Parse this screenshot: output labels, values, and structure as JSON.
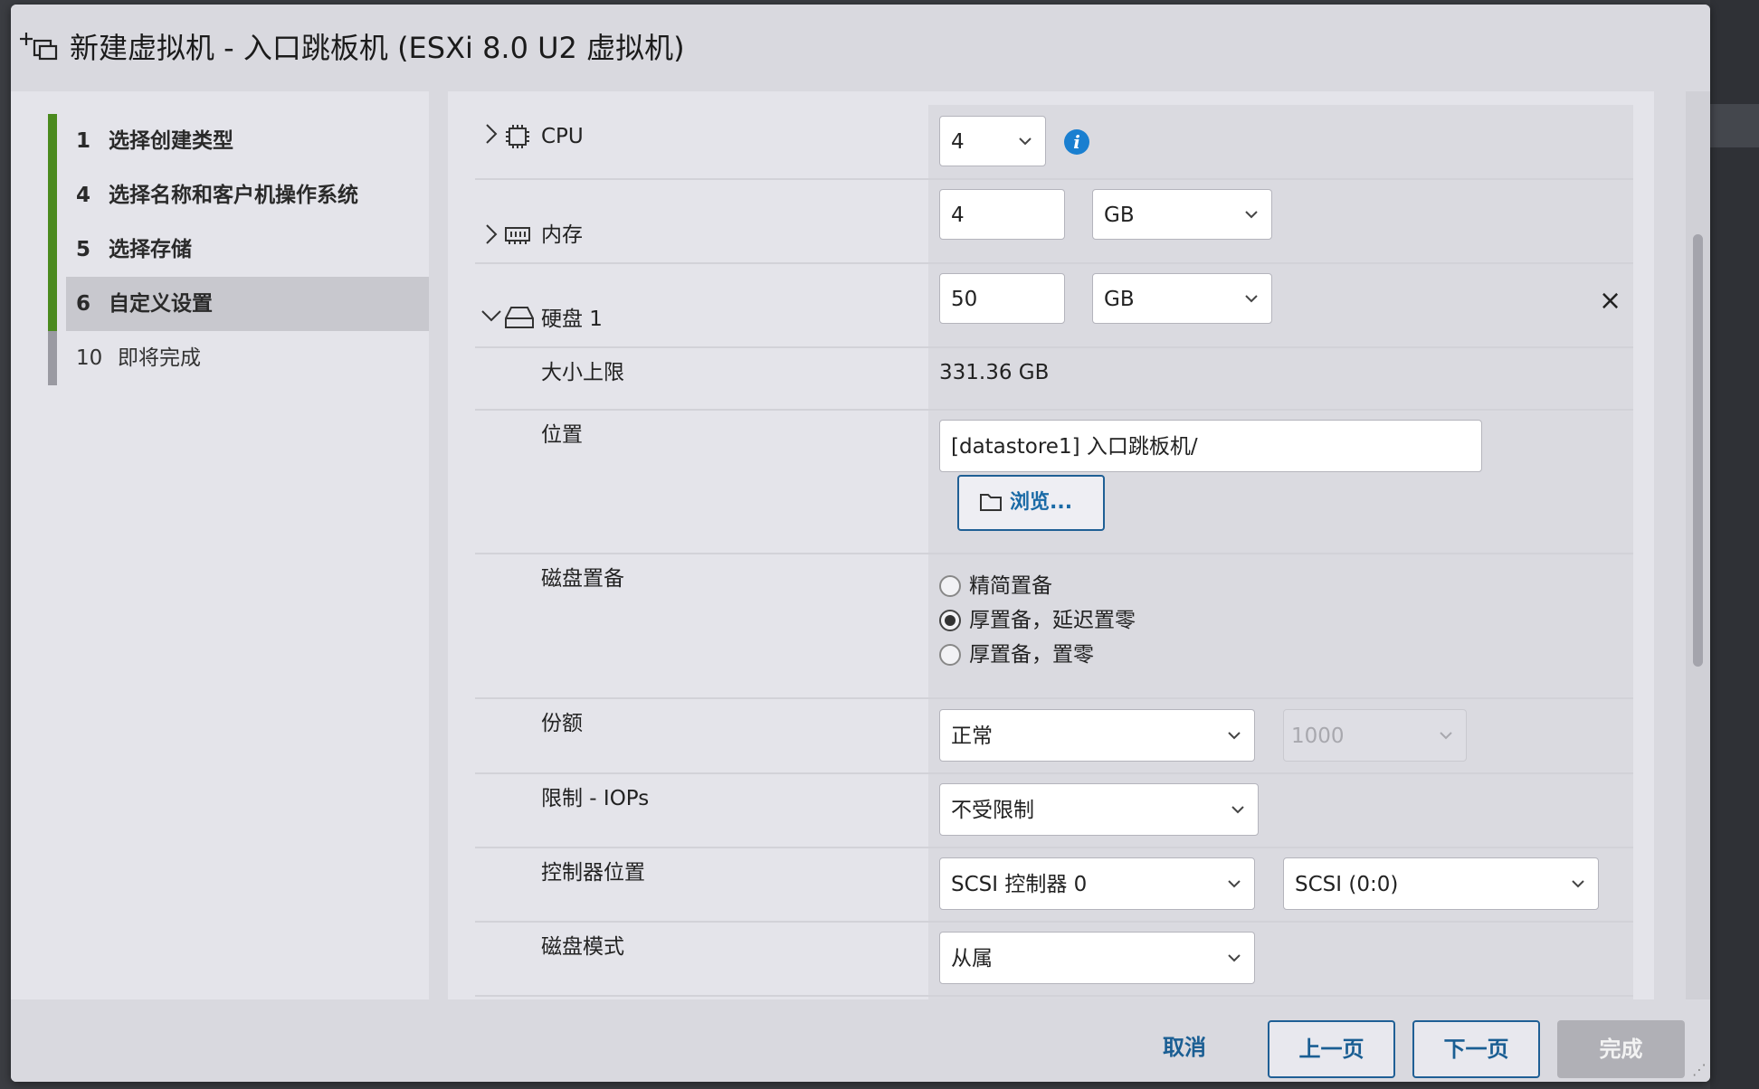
{
  "dialog": {
    "title": "新建虚拟机 - 入口跳板机 (ESXi 8.0 U2 虚拟机)",
    "title_icon": "new-vm-icon"
  },
  "nav": {
    "items": [
      {
        "num": "1",
        "label": "选择创建类型",
        "state": "done"
      },
      {
        "num": "4",
        "label": "选择名称和客户机操作系统",
        "state": "done"
      },
      {
        "num": "5",
        "label": "选择存储",
        "state": "done"
      },
      {
        "num": "6",
        "label": "自定义设置",
        "state": "active"
      },
      {
        "num": "10",
        "label": "即将完成",
        "state": "pending"
      }
    ]
  },
  "hardware": {
    "cpu": {
      "label": "CPU",
      "value": "4",
      "icon": "cpu-icon",
      "info_icon": "i"
    },
    "memory": {
      "label": "内存",
      "value": "4",
      "unit": "GB",
      "icon": "memory-icon"
    },
    "disk": {
      "label": "硬盘 1",
      "value": "50",
      "unit": "GB",
      "icon": "hard-disk-icon",
      "remove": "×",
      "max_size": {
        "label": "大小上限",
        "value": "331.36 GB"
      },
      "location": {
        "label": "位置",
        "value": "[datastore1] 入口跳板机/",
        "browse": "浏览..."
      },
      "provisioning": {
        "label": "磁盘置备",
        "options": [
          "精简置备",
          "厚置备，延迟置零",
          "厚置备，置零"
        ],
        "selected": 1
      },
      "shares": {
        "label": "份额",
        "value": "正常",
        "amount": "1000"
      },
      "limit_iops": {
        "label": "限制 - IOPs",
        "value": "不受限制"
      },
      "controller": {
        "label": "控制器位置",
        "controller": "SCSI 控制器 0",
        "slot": "SCSI (0:0)"
      },
      "mode": {
        "label": "磁盘模式",
        "value": "从属"
      }
    }
  },
  "footer": {
    "cancel": "取消",
    "back": "上一页",
    "next": "下一页",
    "finish": "完成"
  },
  "colors": {
    "nav_done_bar": "#4a8a1e",
    "nav_pending_bar": "#9a9aa2",
    "primary_blue": "#1a6aa6",
    "info_blue": "#1a7fd0"
  }
}
